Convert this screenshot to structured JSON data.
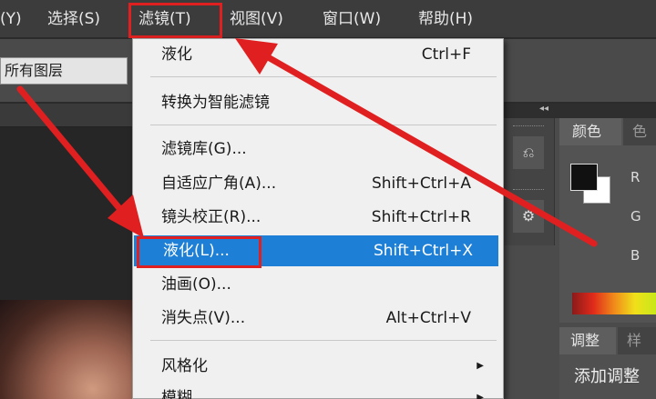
{
  "menubar": {
    "items": [
      "(Y)",
      "选择(S)",
      "滤镜(T)",
      "视图(V)",
      "窗口(W)",
      "帮助(H)"
    ]
  },
  "options_bar": {
    "layer_select_value": "所有图层"
  },
  "filter_menu": {
    "items": [
      {
        "label": "液化",
        "shortcut": "Ctrl+F"
      },
      {
        "label": "转换为智能滤镜",
        "shortcut": ""
      },
      {
        "label": "滤镜库(G)...",
        "shortcut": ""
      },
      {
        "label": "自适应广角(A)...",
        "shortcut": "Shift+Ctrl+A"
      },
      {
        "label": "镜头校正(R)...",
        "shortcut": "Shift+Ctrl+R"
      },
      {
        "label": "液化(L)...",
        "shortcut": "Shift+Ctrl+X"
      },
      {
        "label": "油画(O)...",
        "shortcut": ""
      },
      {
        "label": "消失点(V)...",
        "shortcut": "Alt+Ctrl+V"
      },
      {
        "label": "风格化",
        "shortcut": ""
      },
      {
        "label": "模糊",
        "shortcut": ""
      }
    ],
    "selected_index": 5
  },
  "color_panel": {
    "tab_label": "颜色",
    "tab_label_2": "色",
    "channels": [
      "R",
      "G",
      "B"
    ],
    "foreground_color": "#111111",
    "background_color": "#ffffff"
  },
  "adjust_panel": {
    "tab_label": "调整",
    "tab_label_2": "样",
    "add_label": "添加调整"
  },
  "icons": {
    "collapse": "double-chevron-left-icon",
    "submenu": "triangle-right-icon"
  },
  "colors": {
    "highlight": "#1e7fd6",
    "annotation_red": "#e02020"
  }
}
